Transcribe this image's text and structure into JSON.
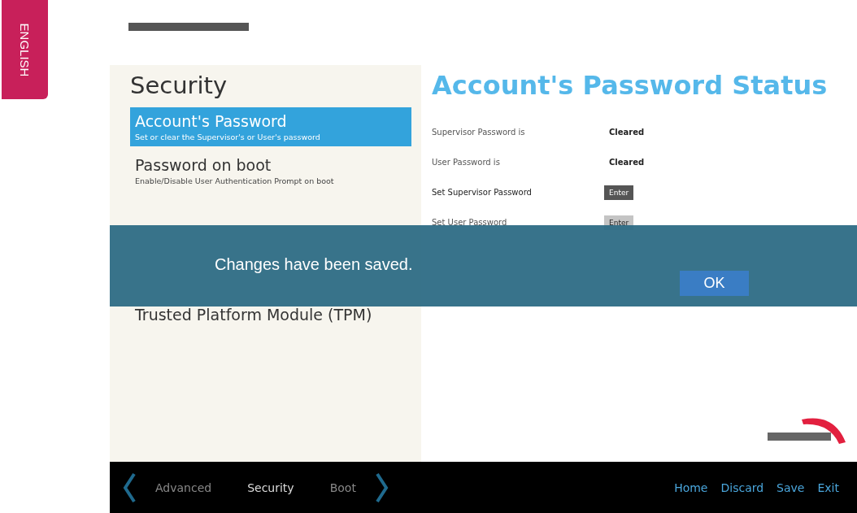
{
  "language_tab": {
    "label": "ENGLISH"
  },
  "sidebar": {
    "title": "Security",
    "items": [
      {
        "title": "Account's Password",
        "subtitle": "Set or clear the Supervisor's or User's password",
        "selected": true
      },
      {
        "title": "Password on boot",
        "subtitle": "Enable/Disable User Authentication Prompt on boot",
        "selected": false
      },
      {
        "title": "Trusted Platform Module (TPM)",
        "selected": false
      }
    ]
  },
  "panel": {
    "title": "Account's Password Status",
    "rows": [
      {
        "kind": "status",
        "label": "Supervisor Password is",
        "value": "Cleared"
      },
      {
        "kind": "status",
        "label": "User Password is",
        "value": "Cleared"
      },
      {
        "kind": "action",
        "label": "Set Supervisor Password",
        "value": "Enter",
        "disabled": false
      },
      {
        "kind": "action",
        "label": "Set User Password",
        "value": "Enter",
        "disabled": true
      }
    ]
  },
  "bottom_bar": {
    "tabs": [
      {
        "label": "Advanced",
        "selected": false
      },
      {
        "label": "Security",
        "selected": true
      },
      {
        "label": "Boot",
        "selected": false
      }
    ],
    "actions": [
      "Home",
      "Discard",
      "Save",
      "Exit"
    ]
  },
  "dialog": {
    "message": "Changes have been saved.",
    "button": "OK"
  }
}
